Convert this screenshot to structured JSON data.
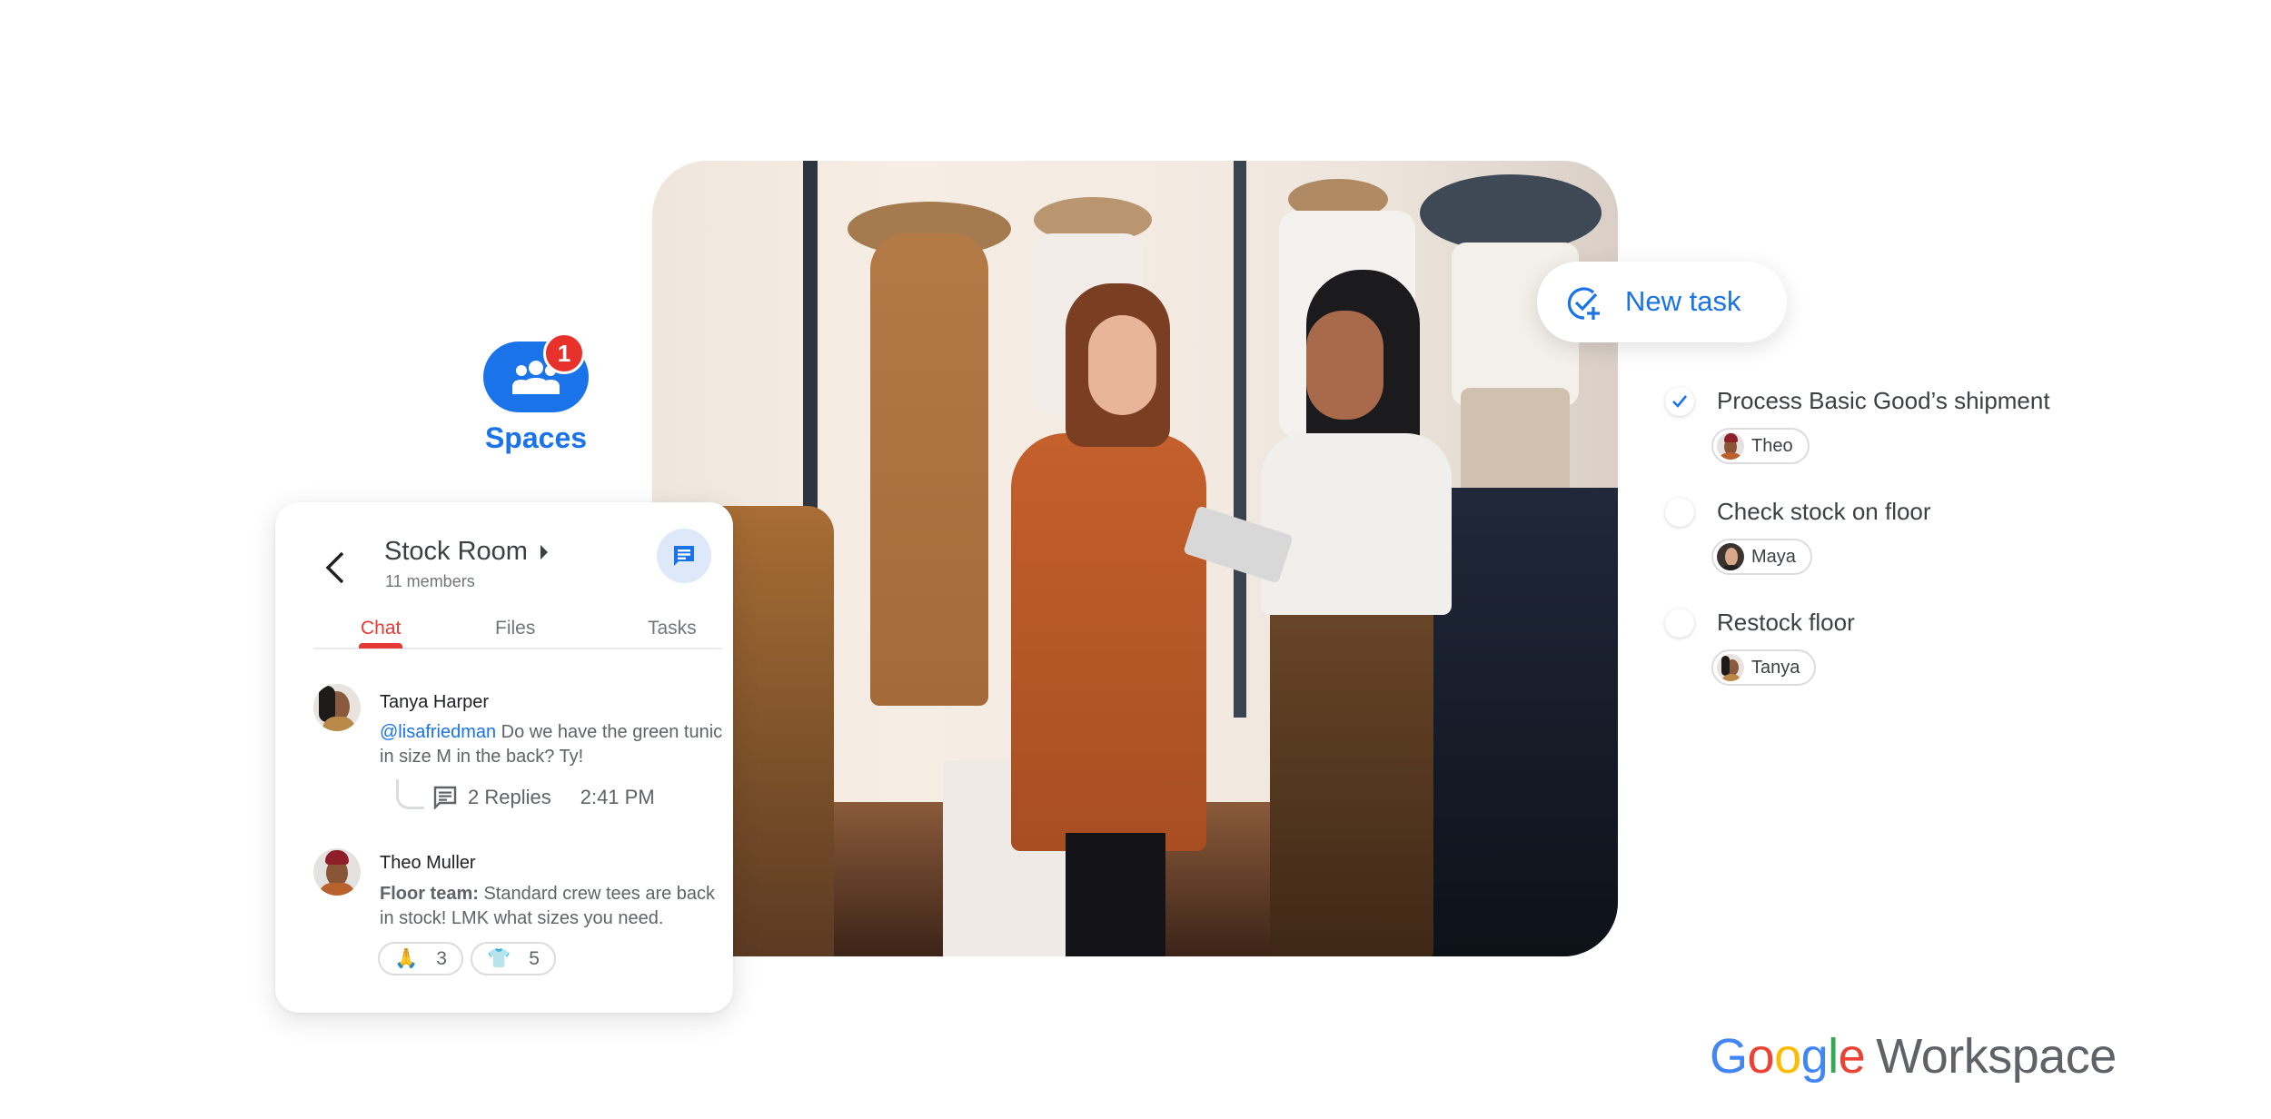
{
  "photo": {
    "subject": "two women in a clothing boutique looking at a tablet"
  },
  "spaces": {
    "label": "Spaces",
    "badge_count": "1",
    "icon": "people-group-icon",
    "color": "#1a73e8",
    "badge_color": "#e8312a"
  },
  "chat_card": {
    "back_icon": "chevron-left-icon",
    "room_title": "Stock Room",
    "room_caret_icon": "caret-right-icon",
    "members": "11 members",
    "fab_icon": "chat-bubble-icon",
    "tabs": [
      {
        "label": "Chat",
        "active": true
      },
      {
        "label": "Files",
        "active": false
      },
      {
        "label": "Tasks",
        "active": false
      }
    ],
    "accent_color": "#e53935",
    "messages": [
      {
        "author": "Tanya Harper",
        "mention": "@lisafriedman",
        "text": " Do we have the green tunic in size M in the back? Ty!",
        "replies_label": "2 Replies",
        "time": "2:41 PM"
      },
      {
        "author": "Theo Muller",
        "bold_prefix": "Floor team:",
        "text": " Standard crew tees are back in stock! LMK what sizes you need.",
        "reactions": [
          {
            "emoji": "🙏",
            "count": "3"
          },
          {
            "emoji": "👕",
            "count": "5"
          }
        ]
      }
    ]
  },
  "new_task": {
    "label": "New task",
    "icon": "add-task-icon",
    "color": "#1a73e8"
  },
  "tasks": [
    {
      "title": "Process Basic Good’s shipment",
      "completed": true,
      "assignee": "Theo"
    },
    {
      "title": "Check stock on floor",
      "completed": false,
      "assignee": "Maya"
    },
    {
      "title": "Restock floor",
      "completed": false,
      "assignee": "Tanya"
    }
  ],
  "logo": {
    "google": [
      "G",
      "o",
      "o",
      "g",
      "l",
      "e"
    ],
    "product": "Workspace"
  }
}
